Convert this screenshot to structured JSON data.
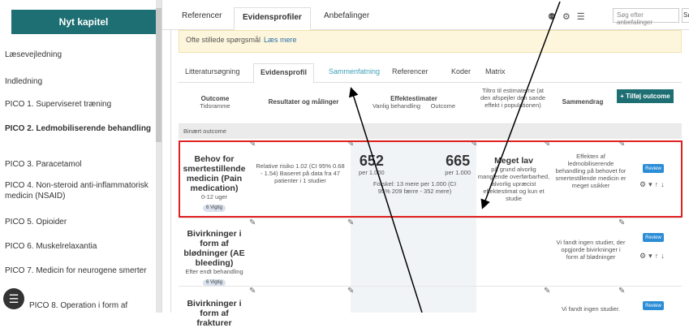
{
  "sidebar": {
    "new_chapter": "Nyt kapitel",
    "items": [
      {
        "label": "Læsevejledning"
      },
      {
        "label": "Indledning"
      },
      {
        "label": "PICO 1. Superviseret træning"
      },
      {
        "label": "PICO 2. Ledmobiliserende behandling"
      },
      {
        "label": "PICO 3. Paracetamol"
      },
      {
        "label": "PICO 4. Non-steroid anti-inflammatorisk medicin (NSAID)"
      },
      {
        "label": "PICO 5. Opioider"
      },
      {
        "label": "PICO 6. Muskelrelaxantia"
      },
      {
        "label": "PICO 7. Medicin for neurogene smerter"
      },
      {
        "label": "PICO 8. Operation i form af"
      }
    ],
    "fab_icon": "list-icon"
  },
  "top_tabs": [
    "Referencer",
    "Evidensprofiler",
    "Anbefalinger"
  ],
  "search": {
    "placeholder": "Søg efter anbefalinger",
    "button": "Sø"
  },
  "notice": {
    "text": "Ofte stillede spørgsmål",
    "link": "Læs mere"
  },
  "sub_tabs": [
    "Litteratursøgning",
    "Evidensprofil",
    "Sammenfatning",
    "Referencer",
    "Koder",
    "Matrix"
  ],
  "header": {
    "outcome": "Outcome",
    "timeframe": "Tidsramme",
    "results": "Resultater og målinger",
    "effect": "Effektestimater",
    "usual": "Vanlig behandling",
    "outcome2": "Outcome",
    "trust": "Tiltro til estimaterne (at den afspejler den sande effekt i populationen)",
    "summary": "Sammendrag",
    "add": "+ Tilføj outcome"
  },
  "section": "Binært outcome",
  "rows": [
    {
      "title": "Behov for smertestillende medicin (Pain medication)",
      "time": "0-12 uger",
      "n": "6",
      "imp": "Vigtig",
      "res": "Relative risiko 1.02 (CI 95% 0.68 - 1.54) Baseret på data fra 47 patienter i 1 studier",
      "v1": "652",
      "v1s": "per 1.000",
      "v2": "665",
      "v2s": "per 1.000",
      "diff": "Forskel: 13 mere per 1.000 (CI 95% 209 færre - 352 mere)",
      "cert": "Meget lav",
      "certd": "på grund alvorlig manglende overførbarhed, alvorlig upræcist effektestimat og kun et studie",
      "sum": "Effekten af ledmobiliserende behandling på behovet for smertestillende medicin er meget usikker",
      "review": "Review"
    },
    {
      "title": "Bivirkninger i form af blødninger (AE bleeding)",
      "time": "Efter endt behandling",
      "n": "6",
      "imp": "Vigtig",
      "sum": "Vi fandt ingen studier, der opgjorde bivirkninger i form af blødninger",
      "review": "Review"
    },
    {
      "title": "Bivirkninger i form af frakturer",
      "sum": "Vi fandt ingen studier.",
      "review": "Review"
    }
  ]
}
